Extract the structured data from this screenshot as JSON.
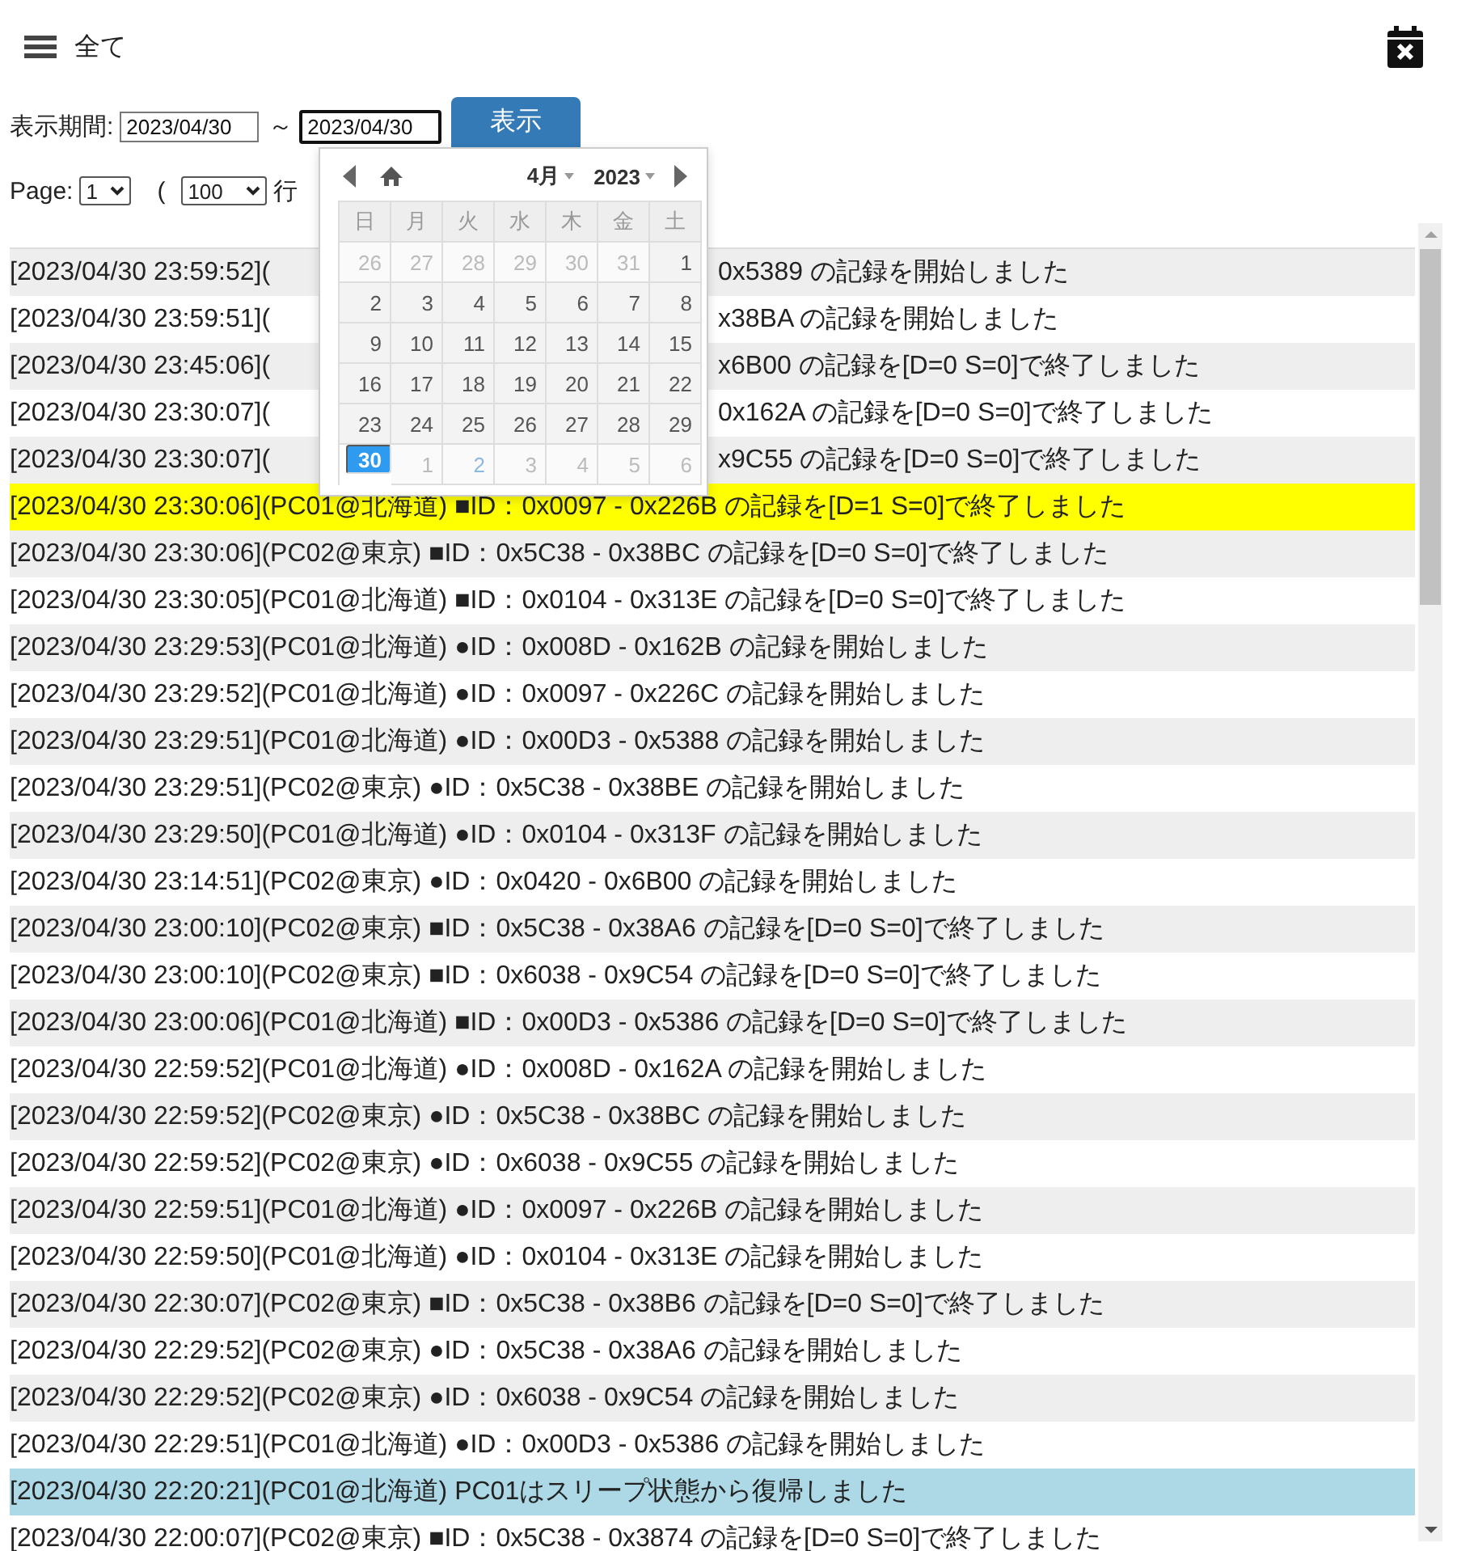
{
  "header": {
    "title": "全て"
  },
  "filter": {
    "label": "表示期間:",
    "from": "2023/04/30",
    "separator": "～",
    "to": "2023/04/30",
    "submit": "表示"
  },
  "paging": {
    "page_label": "Page:",
    "page": "1",
    "paren": "(",
    "rows_per_page": "100",
    "rows_suffix": "行"
  },
  "datepicker": {
    "month": "4月",
    "year": "2023",
    "weekdays": [
      "日",
      "月",
      "火",
      "水",
      "木",
      "金",
      "土"
    ],
    "days": [
      {
        "label": "26",
        "other_month": true,
        "selected": false,
        "today": false
      },
      {
        "label": "27",
        "other_month": true,
        "selected": false,
        "today": false
      },
      {
        "label": "28",
        "other_month": true,
        "selected": false,
        "today": false
      },
      {
        "label": "29",
        "other_month": true,
        "selected": false,
        "today": false
      },
      {
        "label": "30",
        "other_month": true,
        "selected": false,
        "today": false
      },
      {
        "label": "31",
        "other_month": true,
        "selected": false,
        "today": false
      },
      {
        "label": "1",
        "other_month": false,
        "selected": false,
        "today": false
      },
      {
        "label": "2",
        "other_month": false,
        "selected": false,
        "today": false
      },
      {
        "label": "3",
        "other_month": false,
        "selected": false,
        "today": false
      },
      {
        "label": "4",
        "other_month": false,
        "selected": false,
        "today": false
      },
      {
        "label": "5",
        "other_month": false,
        "selected": false,
        "today": false
      },
      {
        "label": "6",
        "other_month": false,
        "selected": false,
        "today": false
      },
      {
        "label": "7",
        "other_month": false,
        "selected": false,
        "today": false
      },
      {
        "label": "8",
        "other_month": false,
        "selected": false,
        "today": false
      },
      {
        "label": "9",
        "other_month": false,
        "selected": false,
        "today": false
      },
      {
        "label": "10",
        "other_month": false,
        "selected": false,
        "today": false
      },
      {
        "label": "11",
        "other_month": false,
        "selected": false,
        "today": false
      },
      {
        "label": "12",
        "other_month": false,
        "selected": false,
        "today": false
      },
      {
        "label": "13",
        "other_month": false,
        "selected": false,
        "today": false
      },
      {
        "label": "14",
        "other_month": false,
        "selected": false,
        "today": false
      },
      {
        "label": "15",
        "other_month": false,
        "selected": false,
        "today": false
      },
      {
        "label": "16",
        "other_month": false,
        "selected": false,
        "today": false
      },
      {
        "label": "17",
        "other_month": false,
        "selected": false,
        "today": false
      },
      {
        "label": "18",
        "other_month": false,
        "selected": false,
        "today": false
      },
      {
        "label": "19",
        "other_month": false,
        "selected": false,
        "today": false
      },
      {
        "label": "20",
        "other_month": false,
        "selected": false,
        "today": false
      },
      {
        "label": "21",
        "other_month": false,
        "selected": false,
        "today": false
      },
      {
        "label": "22",
        "other_month": false,
        "selected": false,
        "today": false
      },
      {
        "label": "23",
        "other_month": false,
        "selected": false,
        "today": false
      },
      {
        "label": "24",
        "other_month": false,
        "selected": false,
        "today": false
      },
      {
        "label": "25",
        "other_month": false,
        "selected": false,
        "today": false
      },
      {
        "label": "26",
        "other_month": false,
        "selected": false,
        "today": false
      },
      {
        "label": "27",
        "other_month": false,
        "selected": false,
        "today": false
      },
      {
        "label": "28",
        "other_month": false,
        "selected": false,
        "today": false
      },
      {
        "label": "29",
        "other_month": false,
        "selected": false,
        "today": false
      },
      {
        "label": "30",
        "other_month": false,
        "selected": true,
        "today": false
      },
      {
        "label": "1",
        "other_month": true,
        "selected": false,
        "today": false
      },
      {
        "label": "2",
        "other_month": true,
        "selected": false,
        "today": true
      },
      {
        "label": "3",
        "other_month": true,
        "selected": false,
        "today": false
      },
      {
        "label": "4",
        "other_month": true,
        "selected": false,
        "today": false
      },
      {
        "label": "5",
        "other_month": true,
        "selected": false,
        "today": false
      },
      {
        "label": "6",
        "other_month": true,
        "selected": false,
        "today": false
      }
    ]
  },
  "log": [
    {
      "text": "[2023/04/30 23:59:52](",
      "tail": "0x5389 の記録を開始しました"
    },
    {
      "text": "[2023/04/30 23:59:51](",
      "tail": "x38BA の記録を開始しました"
    },
    {
      "text": "[2023/04/30 23:45:06](",
      "tail": "x6B00 の記録を[D=0 S=0]で終了しました"
    },
    {
      "text": "[2023/04/30 23:30:07](",
      "tail": "0x162A の記録を[D=0 S=0]で終了しました"
    },
    {
      "text": "[2023/04/30 23:30:07](",
      "tail": "x9C55 の記録を[D=0 S=0]で終了しました"
    },
    {
      "text": "[2023/04/30 23:30:06](PC01@北海道) ■ID：0x0097 - 0x226B の記録を[D=1 S=0]で終了しました",
      "color": "#ffff00"
    },
    {
      "text": "[2023/04/30 23:30:06](PC02@東京) ■ID：0x5C38 - 0x38BC の記録を[D=0 S=0]で終了しました"
    },
    {
      "text": "[2023/04/30 23:30:05](PC01@北海道) ■ID：0x0104 - 0x313E の記録を[D=0 S=0]で終了しました"
    },
    {
      "text": "[2023/04/30 23:29:53](PC01@北海道) ●ID：0x008D - 0x162B の記録を開始しました"
    },
    {
      "text": "[2023/04/30 23:29:52](PC01@北海道) ●ID：0x0097 - 0x226C の記録を開始しました"
    },
    {
      "text": "[2023/04/30 23:29:51](PC01@北海道) ●ID：0x00D3 - 0x5388 の記録を開始しました"
    },
    {
      "text": "[2023/04/30 23:29:51](PC02@東京) ●ID：0x5C38 - 0x38BE の記録を開始しました"
    },
    {
      "text": "[2023/04/30 23:29:50](PC01@北海道) ●ID：0x0104 - 0x313F の記録を開始しました"
    },
    {
      "text": "[2023/04/30 23:14:51](PC02@東京) ●ID：0x0420 - 0x6B00 の記録を開始しました"
    },
    {
      "text": "[2023/04/30 23:00:10](PC02@東京) ■ID：0x5C38 - 0x38A6 の記録を[D=0 S=0]で終了しました"
    },
    {
      "text": "[2023/04/30 23:00:10](PC02@東京) ■ID：0x6038 - 0x9C54 の記録を[D=0 S=0]で終了しました"
    },
    {
      "text": "[2023/04/30 23:00:06](PC01@北海道) ■ID：0x00D3 - 0x5386 の記録を[D=0 S=0]で終了しました"
    },
    {
      "text": "[2023/04/30 22:59:52](PC01@北海道) ●ID：0x008D - 0x162A の記録を開始しました"
    },
    {
      "text": "[2023/04/30 22:59:52](PC02@東京) ●ID：0x5C38 - 0x38BC の記録を開始しました"
    },
    {
      "text": "[2023/04/30 22:59:52](PC02@東京) ●ID：0x6038 - 0x9C55 の記録を開始しました"
    },
    {
      "text": "[2023/04/30 22:59:51](PC01@北海道) ●ID：0x0097 - 0x226B の記録を開始しました"
    },
    {
      "text": "[2023/04/30 22:59:50](PC01@北海道) ●ID：0x0104 - 0x313E の記録を開始しました"
    },
    {
      "text": "[2023/04/30 22:30:07](PC02@東京) ■ID：0x5C38 - 0x38B6 の記録を[D=0 S=0]で終了しました"
    },
    {
      "text": "[2023/04/30 22:29:52](PC02@東京) ●ID：0x5C38 - 0x38A6 の記録を開始しました"
    },
    {
      "text": "[2023/04/30 22:29:52](PC02@東京) ●ID：0x6038 - 0x9C54 の記録を開始しました"
    },
    {
      "text": "[2023/04/30 22:29:51](PC01@北海道) ●ID：0x00D3 - 0x5386 の記録を開始しました"
    },
    {
      "text": "[2023/04/30 22:20:21](PC01@北海道) PC01はスリープ状態から復帰しました",
      "color": "#add8e6"
    },
    {
      "text": "[2023/04/30 22:00:07](PC02@東京) ■ID：0x5C38 - 0x3874 の記録を[D=0 S=0]で終了しました"
    }
  ]
}
